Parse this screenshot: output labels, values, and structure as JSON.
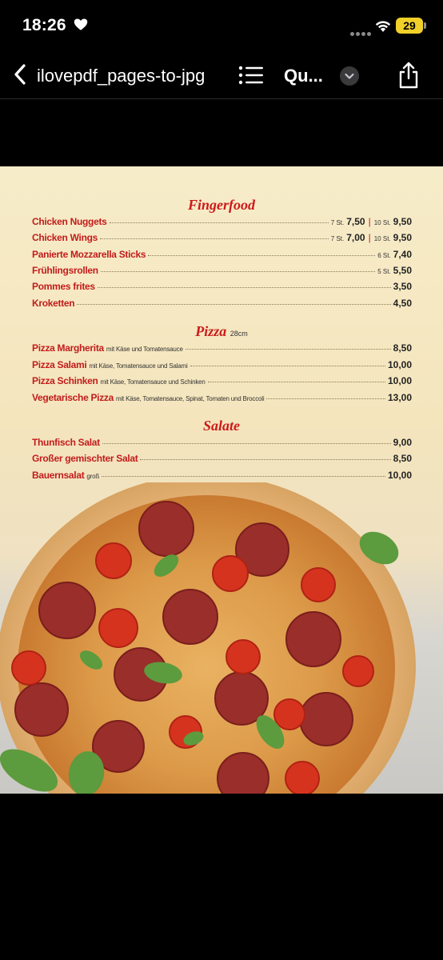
{
  "status": {
    "time": "18:26",
    "battery": "29"
  },
  "nav": {
    "title": "ilovepdf_pages-to-jpg",
    "short_title": "Qu..."
  },
  "menu": {
    "fingerfood": {
      "title": "Fingerfood",
      "items": [
        {
          "name": "Chicken Nuggets",
          "size_a": "7 St.",
          "price_a": "7,50",
          "size_b": "10 St.",
          "price_b": "9,50"
        },
        {
          "name": "Chicken Wings",
          "size_a": "7 St.",
          "price_a": "7,00",
          "size_b": "10 St.",
          "price_b": "9,50"
        },
        {
          "name": "Panierte Mozzarella Sticks",
          "size": "6 St.",
          "price": "7,40"
        },
        {
          "name": "Frühlingsrollen",
          "size": "5 St.",
          "price": "5,50"
        },
        {
          "name": "Pommes frites",
          "price": "3,50"
        },
        {
          "name": "Kroketten",
          "price": "4,50"
        }
      ]
    },
    "pizza": {
      "title": "Pizza",
      "subtitle": "28cm",
      "items": [
        {
          "name": "Pizza Margherita",
          "desc": "mit Käse und Tomatensauce",
          "price": "8,50"
        },
        {
          "name": "Pizza Salami",
          "desc": "mit Käse, Tomatensauce und Salami",
          "price": "10,00"
        },
        {
          "name": "Pizza Schinken",
          "desc": "mit Käse, Tomatensauce und Schinken",
          "price": "10,00"
        },
        {
          "name": "Vegetarische Pizza",
          "desc": "mit Käse, Tomatensauce, Spinat, Tomaten und Broccoli",
          "price": "13,00"
        }
      ]
    },
    "salate": {
      "title": "Salate",
      "items": [
        {
          "name": "Thunfisch Salat",
          "price": "9,00"
        },
        {
          "name": "Großer gemischter Salat",
          "price": "8,50"
        },
        {
          "name": "Bauernsalat",
          "desc": "groß",
          "price": "10,00"
        }
      ]
    }
  },
  "colors": {
    "accent_red": "#cc1a1a",
    "battery_yellow": "#f1d02a"
  },
  "icons": [
    "heart-icon",
    "wifi-icon",
    "back-chevron-icon",
    "list-icon",
    "chevron-down-icon",
    "share-icon"
  ]
}
